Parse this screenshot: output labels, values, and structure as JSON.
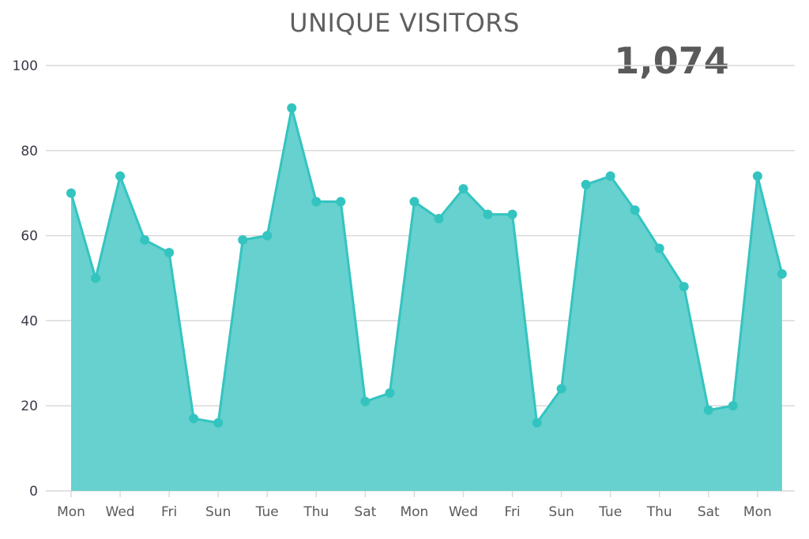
{
  "header": {
    "title": "UNIQUE VISITORS",
    "total": "1,074"
  },
  "colors": {
    "line": "#34c4c0",
    "fill": "#66d1ce",
    "grid": "#d9d9d9"
  },
  "chart_data": {
    "type": "area",
    "title": "UNIQUE VISITORS",
    "annotation": "1,074",
    "xlabel": "",
    "ylabel": "",
    "ylim": [
      0,
      100
    ],
    "yticks": [
      0,
      20,
      40,
      60,
      80,
      100
    ],
    "grid": true,
    "x": [
      "Mon",
      "Tue",
      "Wed",
      "Thu",
      "Fri",
      "Sat",
      "Sun",
      "Mon",
      "Tue",
      "Wed",
      "Thu",
      "Fri",
      "Sat",
      "Sun",
      "Mon",
      "Tue",
      "Wed",
      "Thu",
      "Fri",
      "Sat",
      "Sun",
      "Mon",
      "Tue",
      "Wed",
      "Thu",
      "Fri",
      "Sat",
      "Sun",
      "Mon",
      "Tue"
    ],
    "xtick_labels": [
      "Mon",
      "Wed",
      "Fri",
      "Sun",
      "Tue",
      "Thu",
      "Sat",
      "Mon",
      "Wed",
      "Fri",
      "Sun",
      "Tue",
      "Thu",
      "Sat",
      "Mon"
    ],
    "series": [
      {
        "name": "Unique Visitors",
        "values": [
          70,
          50,
          74,
          59,
          56,
          17,
          16,
          59,
          60,
          90,
          68,
          68,
          21,
          23,
          68,
          64,
          71,
          65,
          65,
          16,
          24,
          72,
          74,
          66,
          57,
          48,
          19,
          20,
          74,
          51
        ]
      }
    ]
  }
}
